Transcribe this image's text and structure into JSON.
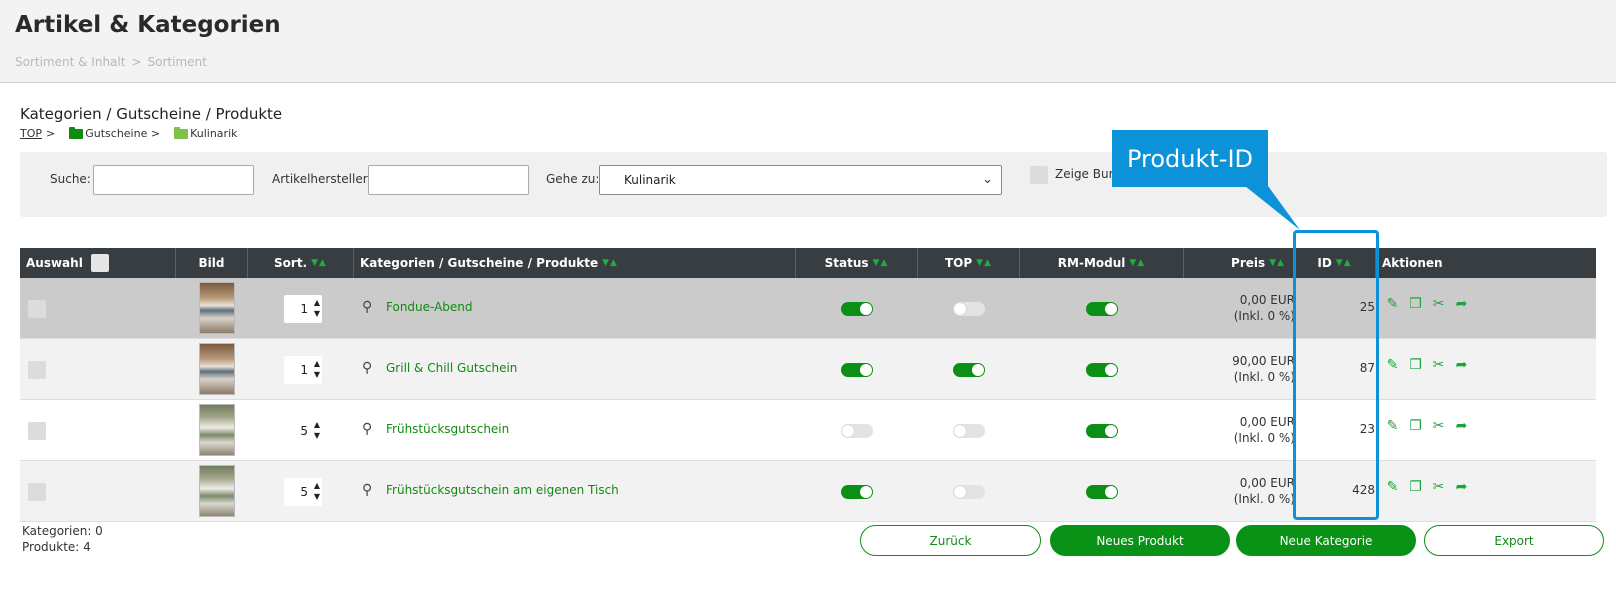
{
  "header": {
    "title": "Artikel & Kategorien",
    "breadcrumb": [
      "Sortiment & Inhalt",
      "Sortiment"
    ],
    "breadcrumb_sep": ">"
  },
  "section": {
    "title": "Kategorien / Gutscheine / Produkte",
    "path_top": "TOP",
    "path_sep": ">",
    "path_folder1": "Gutscheine >",
    "path_folder2": "Kulinarik"
  },
  "filters": {
    "search_label": "Suche:",
    "search_value": "",
    "manufacturer_label": "Artikelhersteller:",
    "manufacturer_value": "",
    "goto_label": "Gehe zu:",
    "goto_value": "Kulinarik",
    "bundle_label": "Zeige Bund"
  },
  "table": {
    "headers": {
      "select": "Auswahl",
      "image": "Bild",
      "sort": "Sort.",
      "name": "Kategorien / Gutscheine / Produkte",
      "status": "Status",
      "top": "TOP",
      "rm": "RM-Modul",
      "price": "Preis",
      "id": "ID",
      "actions": "Aktionen"
    },
    "rows": [
      {
        "sort": "1",
        "name": "Fondue-Abend",
        "status": true,
        "top": false,
        "rm": true,
        "price": "0,00 EUR",
        "tax": "(Inkl. 0 %)",
        "id": "25"
      },
      {
        "sort": "1",
        "name": "Grill & Chill Gutschein",
        "status": true,
        "top": true,
        "rm": true,
        "price": "90,00 EUR",
        "tax": "(Inkl. 0 %)",
        "id": "87"
      },
      {
        "sort": "5",
        "name": "Frühstücksgutschein",
        "status": false,
        "top": false,
        "rm": true,
        "price": "0,00 EUR",
        "tax": "(Inkl. 0 %)",
        "id": "23"
      },
      {
        "sort": "5",
        "name": "Frühstücksgutschein am eigenen Tisch",
        "status": true,
        "top": false,
        "rm": true,
        "price": "0,00 EUR",
        "tax": "(Inkl. 0 %)",
        "id": "428"
      }
    ]
  },
  "footer": {
    "categories": "Kategorien: 0",
    "products": "Produkte: 4",
    "back": "Zurück",
    "new_product": "Neues Produkt",
    "new_category": "Neue Kategorie",
    "export": "Export"
  },
  "annotation": {
    "callout": "Produkt-ID",
    "color": "#0c92d8"
  },
  "colors": {
    "accent_green": "#0a9217",
    "header_dark": "#383d41"
  }
}
